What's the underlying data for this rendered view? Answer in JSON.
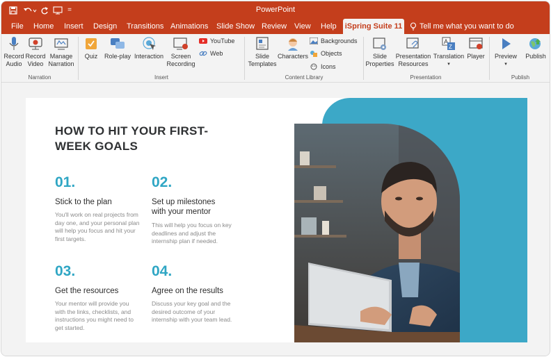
{
  "app": {
    "title": "PowerPoint"
  },
  "colors": {
    "accent": "#c43e1c",
    "teal": "#3ca8c7",
    "number": "#2fa6c4"
  },
  "quick_access": {
    "save_icon": "save-icon",
    "undo_icon": "undo-icon",
    "redo_icon": "redo-icon",
    "slideshow_icon": "slideshow-icon",
    "customize_label": "="
  },
  "tabs": [
    {
      "label": "File"
    },
    {
      "label": "Home"
    },
    {
      "label": "Insert"
    },
    {
      "label": "Design"
    },
    {
      "label": "Transitions"
    },
    {
      "label": "Animations"
    },
    {
      "label": "Slide Show"
    },
    {
      "label": "Review"
    },
    {
      "label": "View"
    },
    {
      "label": "Help"
    },
    {
      "label": "iSpring Suite 11",
      "active": true
    }
  ],
  "tell_me": "Tell me what you want to do",
  "ribbon": {
    "groups": {
      "narration": "Narration",
      "insert": "Insert",
      "content_library": "Content Library",
      "presentation": "Presentation",
      "publish": "Publish"
    },
    "record_audio": "Record\nAudio",
    "record_video": "Record\nVideo",
    "manage_narration": "Manage\nNarration",
    "quiz": "Quiz",
    "role_play": "Role-play",
    "interaction": "Interaction",
    "screen_recording": "Screen\nRecording",
    "youtube": "YouTube",
    "web": "Web",
    "slide_templates": "Slide\nTemplates",
    "characters": "Characters",
    "backgrounds": "Backgrounds",
    "objects": "Objects",
    "icons": "Icons",
    "slide_properties": "Slide\nProperties",
    "presentation_resources": "Presentation\nResources",
    "translation": "Translation",
    "player": "Player",
    "preview": "Preview",
    "publish": "Publish"
  },
  "slide": {
    "headline": "HOW TO HIT YOUR FIRST-WEEK GOALS",
    "items": [
      {
        "number": "01.",
        "title": "Stick to the plan",
        "body": "You'll work on real projects from day one, and your personal plan will help you focus and hit your first targets."
      },
      {
        "number": "02.",
        "title": "Set up milestones with your mentor",
        "body": "This will help you focus on key deadlines and adjust the internship plan if needed."
      },
      {
        "number": "03.",
        "title": "Get the resources",
        "body": "Your mentor will provide you with the links, checklists, and instructions you might need to get started."
      },
      {
        "number": "04.",
        "title": "Agree on the results",
        "body": "Discuss your key goal and the desired outcome of your internship with your team lead."
      }
    ]
  }
}
